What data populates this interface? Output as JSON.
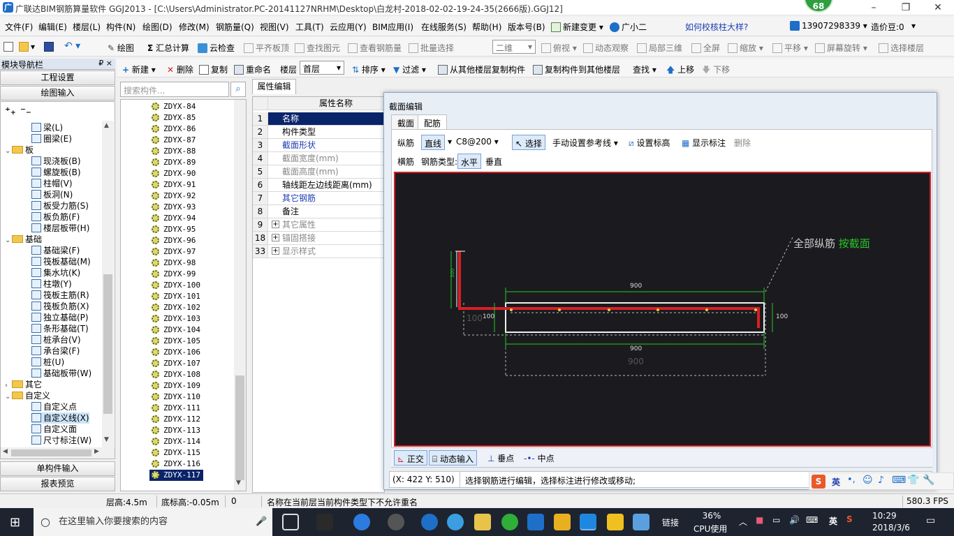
{
  "window": {
    "title": "广联达BIM钢筋算量软件 GGJ2013 - [C:\\Users\\Administrator.PC-20141127NRHM\\Desktop\\白龙村-2018-02-02-19-24-35(2666版).GGJ12]",
    "badge": "68",
    "min": "–",
    "max": "❐",
    "close": "✕"
  },
  "menu": {
    "items": [
      "文件(F)",
      "编辑(E)",
      "楼层(L)",
      "构件(N)",
      "绘图(D)",
      "修改(M)",
      "钢筋量(Q)",
      "视图(V)",
      "工具(T)",
      "云应用(Y)",
      "BIM应用(I)",
      "在线服务(S)",
      "帮助(H)",
      "版本号(B)"
    ],
    "new_change": "新建变更",
    "assistant": "广小二",
    "help_link": "如何校核柱大样?",
    "phone": "13907298339",
    "cost_bean": "造价豆:0"
  },
  "toolbar1": {
    "draw": "绘图",
    "sum": "汇总计算",
    "cloud_check": "云检查",
    "align_slab": "平齐板顶",
    "find_element": "查找图元",
    "view_rebar": "查看钢筋量",
    "batch_select": "批量选择",
    "view_mode": "二维",
    "top_view": "俯视",
    "dynamic_view": "动态观察",
    "local_3d": "局部三维",
    "fullscreen": "全屏",
    "zoom": "缩放",
    "pan": "平移",
    "rotate": "屏幕旋转",
    "select_floor": "选择楼层"
  },
  "toolbar2": {
    "new": "新建",
    "delete": "删除",
    "copy": "复制",
    "rename": "重命名",
    "floor_label": "楼层",
    "floor_value": "首层",
    "sort": "排序",
    "filter": "过滤",
    "copy_from": "从其他楼层复制构件",
    "copy_to": "复制构件到其他楼层",
    "find": "查找",
    "up": "上移",
    "down": "下移"
  },
  "nav": {
    "header": "模块导航栏",
    "pin": "₽ ×",
    "project_settings": "工程设置",
    "drawing_input": "绘图输入",
    "single_input": "单构件输入",
    "report_preview": "报表预览",
    "tree": [
      {
        "label": "梁(L)",
        "level": 2
      },
      {
        "label": "圈梁(E)",
        "level": 2
      },
      {
        "label": "板",
        "level": 1,
        "folder": true,
        "expanded": true
      },
      {
        "label": "现浇板(B)",
        "level": 2
      },
      {
        "label": "螺旋板(B)",
        "level": 2
      },
      {
        "label": "柱帽(V)",
        "level": 2
      },
      {
        "label": "板洞(N)",
        "level": 2
      },
      {
        "label": "板受力筋(S)",
        "level": 2
      },
      {
        "label": "板负筋(F)",
        "level": 2
      },
      {
        "label": "楼层板带(H)",
        "level": 2
      },
      {
        "label": "基础",
        "level": 1,
        "folder": true,
        "expanded": true
      },
      {
        "label": "基础梁(F)",
        "level": 2
      },
      {
        "label": "筏板基础(M)",
        "level": 2
      },
      {
        "label": "集水坑(K)",
        "level": 2
      },
      {
        "label": "柱墩(Y)",
        "level": 2
      },
      {
        "label": "筏板主筋(R)",
        "level": 2
      },
      {
        "label": "筏板负筋(X)",
        "level": 2
      },
      {
        "label": "独立基础(P)",
        "level": 2
      },
      {
        "label": "条形基础(T)",
        "level": 2
      },
      {
        "label": "桩承台(V)",
        "level": 2
      },
      {
        "label": "承台梁(F)",
        "level": 2
      },
      {
        "label": "桩(U)",
        "level": 2
      },
      {
        "label": "基础板带(W)",
        "level": 2
      },
      {
        "label": "其它",
        "level": 1,
        "folder": true,
        "expanded": false
      },
      {
        "label": "自定义",
        "level": 1,
        "folder": true,
        "expanded": true
      },
      {
        "label": "自定义点",
        "level": 2
      },
      {
        "label": "自定义线(X)",
        "level": 2,
        "selected": true
      },
      {
        "label": "自定义面",
        "level": 2
      },
      {
        "label": "尺寸标注(W)",
        "level": 2
      }
    ]
  },
  "search": {
    "placeholder": "搜索构件..."
  },
  "components": [
    "ZDYX-84",
    "ZDYX-85",
    "ZDYX-86",
    "ZDYX-87",
    "ZDYX-88",
    "ZDYX-89",
    "ZDYX-90",
    "ZDYX-91",
    "ZDYX-92",
    "ZDYX-93",
    "ZDYX-94",
    "ZDYX-95",
    "ZDYX-96",
    "ZDYX-97",
    "ZDYX-98",
    "ZDYX-99",
    "ZDYX-100",
    "ZDYX-101",
    "ZDYX-102",
    "ZDYX-103",
    "ZDYX-104",
    "ZDYX-105",
    "ZDYX-106",
    "ZDYX-107",
    "ZDYX-108",
    "ZDYX-109",
    "ZDYX-110",
    "ZDYX-111",
    "ZDYX-112",
    "ZDYX-113",
    "ZDYX-114",
    "ZDYX-115",
    "ZDYX-116",
    "ZDYX-117"
  ],
  "selected_component": "ZDYX-117",
  "props": {
    "tab": "属性编辑",
    "header": "属性名称",
    "rows": [
      {
        "num": "1",
        "name": "名称",
        "style": "sel"
      },
      {
        "num": "2",
        "name": "构件类型",
        "style": ""
      },
      {
        "num": "3",
        "name": "截面形状",
        "style": "blue"
      },
      {
        "num": "4",
        "name": "截面宽度(mm)",
        "style": "gray"
      },
      {
        "num": "5",
        "name": "截面高度(mm)",
        "style": "gray"
      },
      {
        "num": "6",
        "name": "轴线距左边线距离(mm)",
        "style": ""
      },
      {
        "num": "7",
        "name": "其它钢筋",
        "style": "blue"
      },
      {
        "num": "8",
        "name": "备注",
        "style": ""
      },
      {
        "num": "9",
        "name": "其它属性",
        "style": "gray",
        "plus": true
      },
      {
        "num": "18",
        "name": "锚固搭接",
        "style": "gray",
        "plus": true
      },
      {
        "num": "33",
        "name": "显示样式",
        "style": "gray",
        "plus": true
      }
    ]
  },
  "section": {
    "title": "截面编辑",
    "tab_section": "截面",
    "tab_rebar": "配筋",
    "long_label": "纵筋",
    "line_mode": "直线",
    "spec": "C8@200",
    "select": "选择",
    "manual_ref": "手动设置参考线",
    "set_elev": "设置标高",
    "show_mark": "显示标注",
    "delete": "删除",
    "trans_label": "横筋",
    "rebar_type": "钢筋类型:",
    "horizontal": "水平",
    "vertical": "垂直",
    "anno_all": "全部纵筋",
    "anno_by": "按截面",
    "dim_top": "900",
    "dim_bottom": "900",
    "dim_bottom2": "900",
    "dim_left": "100",
    "dim_left2": "100",
    "dim_right": "100",
    "dim_vert": "300",
    "ortho": "正交",
    "dyn_input": "动态输入",
    "perp": "垂点",
    "midpoint": "中点",
    "coords": "(X: 422 Y: 510)",
    "hint": "选择钢筋进行编辑，选择标注进行修改或移动;"
  },
  "status": {
    "floor_h": "层高:4.5m",
    "bottom_elev": "底标高:-0.05m",
    "zero": "0",
    "msg": "名称在当前层当前构件类型下不允许重名",
    "fps": "580.3 FPS"
  },
  "taskbar": {
    "search": "在这里输入你要搜索的内容",
    "link": "链接",
    "cpu_pct": "36%",
    "cpu_label": "CPU使用",
    "lang": "英",
    "time": "10:29",
    "date": "2018/3/6"
  },
  "ime": {
    "lang": "英"
  },
  "colors": {
    "rebar": "#d81f26",
    "dim": "#27c427",
    "accent_blue": "#1e6fc8",
    "selection": "#0a246a"
  }
}
